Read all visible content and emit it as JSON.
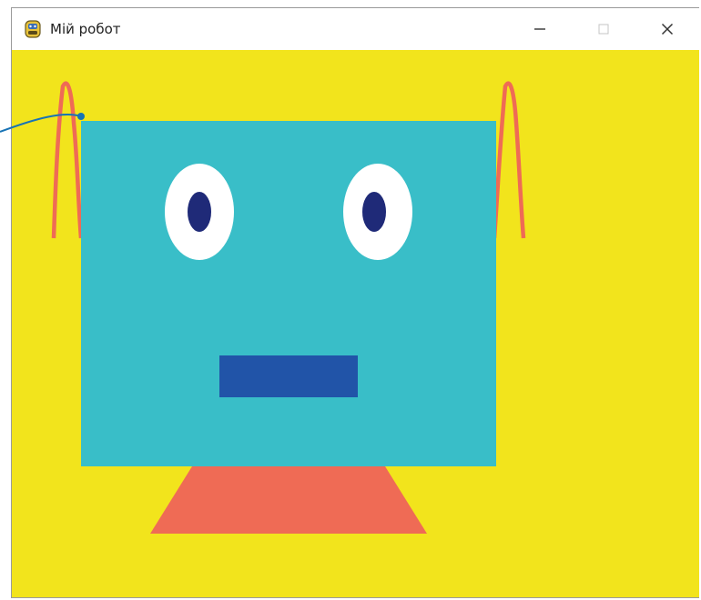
{
  "window": {
    "title": "Мій робот",
    "app_icon": "python-icon",
    "controls": [
      "minimize-icon",
      "maximize-icon",
      "close-icon"
    ]
  },
  "colors": {
    "background": "#f2e41c",
    "face": "#39bec8",
    "eye_white": "#ffffff",
    "pupil": "#1f2a78",
    "mouth": "#2154a8",
    "neck": "#ef6b55",
    "antenna": "#ef6b55",
    "callout_line": "#1873b5"
  }
}
